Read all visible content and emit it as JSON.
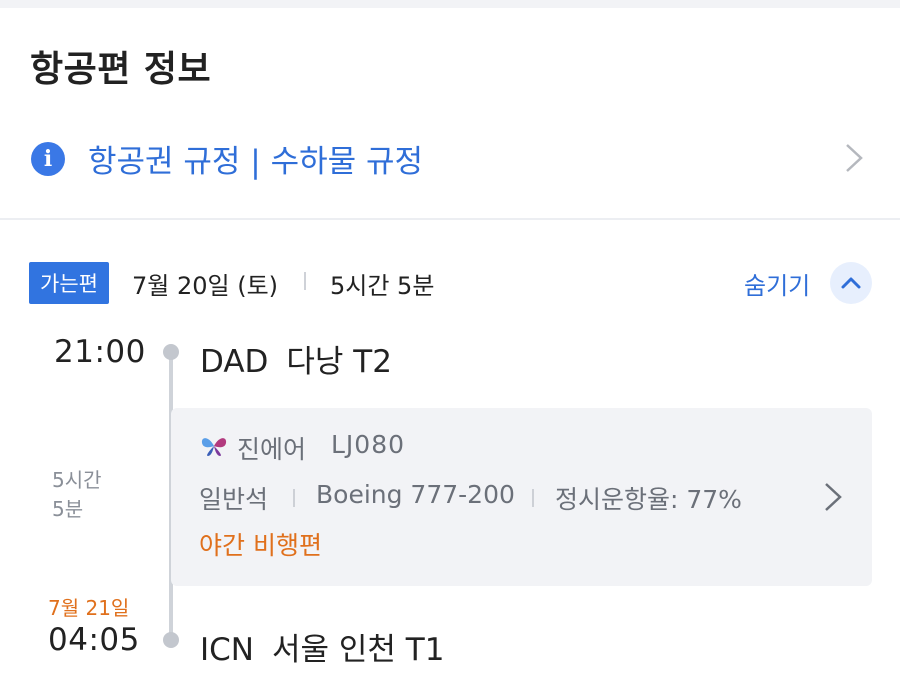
{
  "page": {
    "title": "항공편 정보"
  },
  "policy": {
    "text": "항공권 규정 | 수하물 규정",
    "icon": "info-icon"
  },
  "segment": {
    "direction": "가는편",
    "date": "7월 20일 (토)",
    "duration": "5시간 5분",
    "hide_label": "숨기기",
    "departure": {
      "time": "21:00",
      "code": "DAD",
      "name": "다낭 T2"
    },
    "arrival": {
      "date": "7월 21일",
      "time": "04:05",
      "code": "ICN",
      "name": "서울 인천 T1"
    },
    "duration_lines": [
      "5시간",
      "5분"
    ],
    "flight": {
      "airline": "진에어",
      "flight_no": "LJ080",
      "cabin": "일반석",
      "aircraft": "Boeing 777-200",
      "ontime": "정시운항율: 77%",
      "note": "야간 비행편"
    }
  },
  "colors": {
    "accent": "#3174e0",
    "link": "#2f6ed8",
    "warning": "#e0701c",
    "card_bg": "#f2f3f6"
  }
}
